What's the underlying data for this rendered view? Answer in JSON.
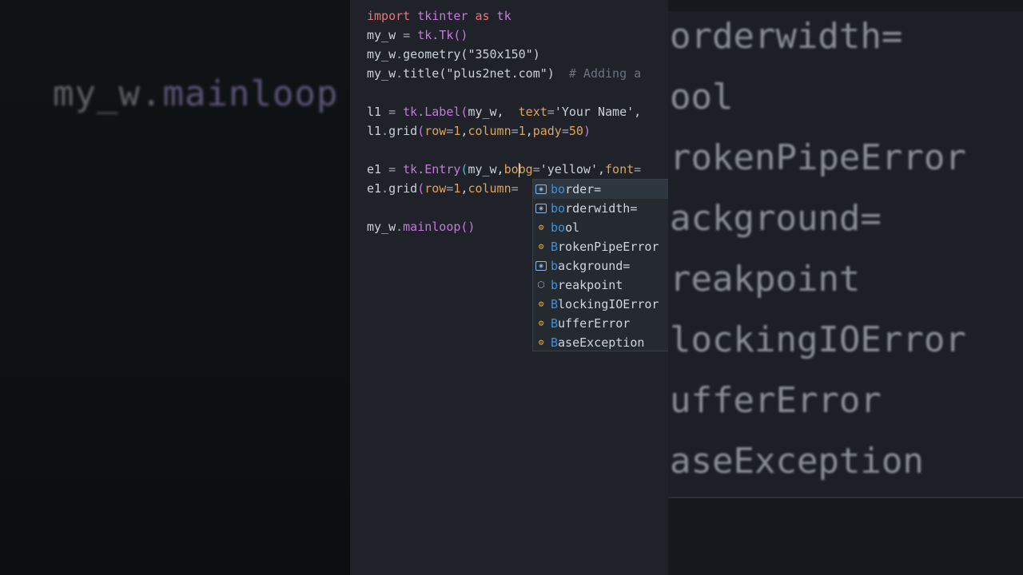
{
  "editor": {
    "line1": [
      "import",
      " tkinter ",
      "as",
      " tk"
    ],
    "line2": [
      "my_w",
      " = ",
      "tk",
      ".",
      "Tk",
      "()"
    ],
    "line3": [
      "my_w",
      ".",
      "geometry",
      "(",
      "\"350x150\"",
      ")"
    ],
    "line4": [
      "my_w",
      ".",
      "title",
      "(",
      "\"plus2net.com\"",
      ")",
      "  # Adding a"
    ],
    "line6": [
      "l1",
      " = ",
      "tk",
      ".",
      "Label",
      "(",
      "my_w,  ",
      "text",
      "=",
      "'Your Name'",
      ","
    ],
    "line7": [
      "l1",
      ".",
      "grid",
      "(",
      "row",
      "=",
      "1",
      ",",
      "column",
      "=",
      "1",
      ",",
      "pady",
      "=",
      "50",
      ")"
    ],
    "line9a": [
      "e1",
      " = ",
      "tk",
      ".",
      "Entry",
      "(",
      "my_w,",
      "bo"
    ],
    "line9b": [
      "bg",
      "=",
      "'yellow'",
      ",",
      "font",
      "="
    ],
    "line10": [
      "e1",
      ".",
      "grid",
      "(",
      "row",
      "=",
      "1",
      ",",
      "column",
      "="
    ],
    "line12": [
      "my_w",
      ".",
      "mainloop",
      "()"
    ]
  },
  "autocomplete": [
    {
      "icon": "field",
      "match": "bo",
      "rest": "rder="
    },
    {
      "icon": "field",
      "match": "bo",
      "rest": "rderwidth="
    },
    {
      "icon": "class",
      "match": "bo",
      "rest": "ol"
    },
    {
      "icon": "class",
      "match": "B",
      "rest": "rokenPipeError"
    },
    {
      "icon": "field",
      "match": "b",
      "rest": "ackground="
    },
    {
      "icon": "module",
      "match": "b",
      "rest": "reakpoint"
    },
    {
      "icon": "class",
      "match": "B",
      "rest": "lockingIOError"
    },
    {
      "icon": "class",
      "match": "B",
      "rest": "ufferError"
    },
    {
      "icon": "class",
      "match": "B",
      "rest": "aseException"
    }
  ],
  "background": {
    "left_ghost": [
      "my_w.",
      "mainloop"
    ],
    "right_ghost": [
      "orderwidth=",
      "ool",
      "rokenPipeError",
      "ackground=",
      "reakpoint",
      "lockingIOError",
      "ufferError",
      "aseException"
    ]
  }
}
